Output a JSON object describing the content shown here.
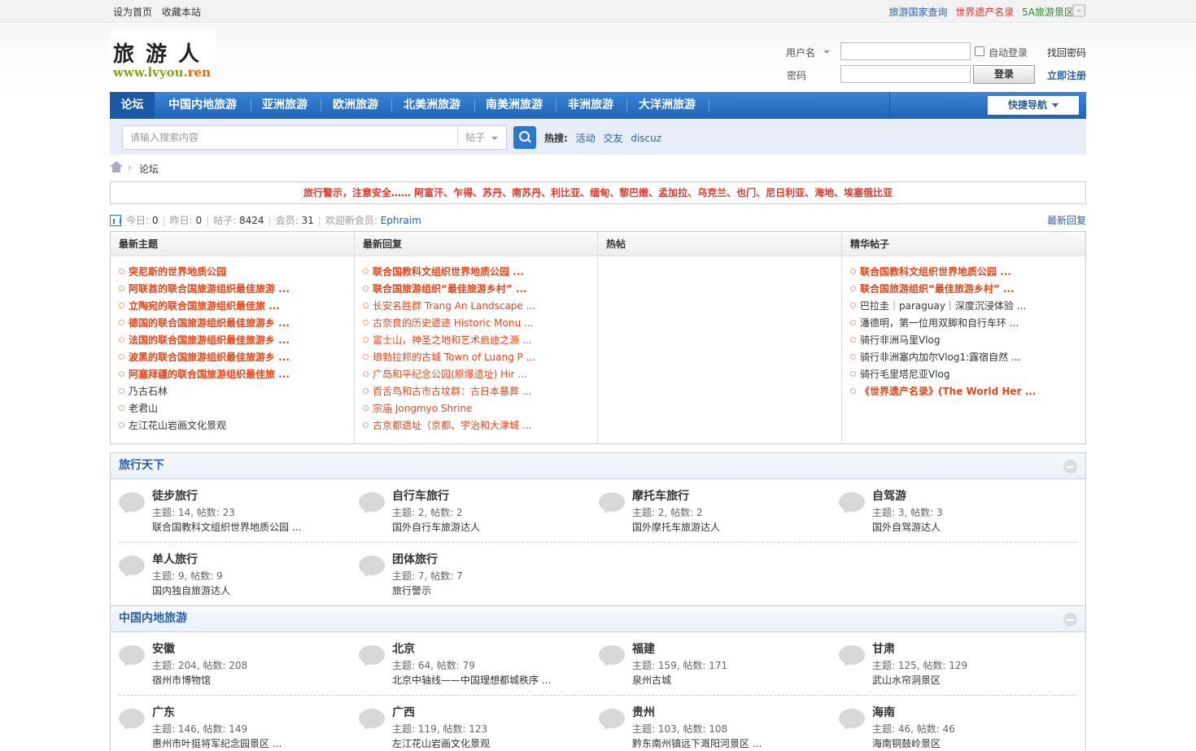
{
  "topbar": {
    "left": [
      "设为首页",
      "收藏本站"
    ],
    "right": [
      {
        "label": "旅游国家查询",
        "color": "#2a5fa7"
      },
      {
        "label": "世界遗产名录",
        "color": "#e4362b"
      },
      {
        "label": "5A旅游景区",
        "color": "#2c8a2c"
      }
    ]
  },
  "logo": {
    "cn": "旅游人",
    "url_prefix": "www.lvyou.",
    "url_suffix": "ren"
  },
  "login": {
    "username_label": "用户名",
    "password_label": "密码",
    "auto_login": "自动登录",
    "find_password": "找回密码",
    "login_button": "登录",
    "register": "立即注册",
    "username_value": "",
    "password_value": ""
  },
  "nav": {
    "items": [
      "论坛",
      "中国内地旅游",
      "亚洲旅游",
      "欧洲旅游",
      "北美洲旅游",
      "南美洲旅游",
      "非洲旅游",
      "大洋洲旅游"
    ],
    "quick": "快捷导航"
  },
  "search": {
    "placeholder": "请输入搜索内容",
    "type": "帖子",
    "hot_label": "热搜:",
    "hot": [
      "活动",
      "交友",
      "discuz"
    ]
  },
  "breadcrumb": {
    "current": "论坛"
  },
  "notice": "旅行警示，注意安全…… 阿富汗、乍得、苏丹、南苏丹、利比亚、缅甸、黎巴嫩、孟加拉、乌克兰、也门、尼日利亚、海地、埃塞俄比亚",
  "stats": {
    "today_label": "今日:",
    "today": "0",
    "yesterday_label": "昨日:",
    "yesterday": "0",
    "posts_label": "帖子:",
    "posts": "8424",
    "members_label": "会员:",
    "members": "31",
    "newmember_label": "欢迎新会员:",
    "newmember": "Ephraim",
    "latest_link": "最新回复"
  },
  "columns": [
    {
      "title": "最新主题",
      "items": [
        {
          "text": "突尼斯的世界地质公园",
          "style": "bold-red"
        },
        {
          "text": "阿联酋的联合国旅游组织最佳旅游 ...",
          "style": "bold-red"
        },
        {
          "text": "立陶宛的联合国旅游组织最佳旅 ...",
          "style": "bold-red"
        },
        {
          "text": "德国的联合国旅游组织最佳旅游乡 ...",
          "style": "bold-red"
        },
        {
          "text": "法国的联合国旅游组织最佳旅游乡 ...",
          "style": "bold-red"
        },
        {
          "text": "波黑的联合国旅游组织最佳旅游乡 ...",
          "style": "bold-red"
        },
        {
          "text": "阿塞拜疆的联合国旅游组织最佳旅 ...",
          "style": "bold-red"
        },
        {
          "text": "乃古石林",
          "style": "dark"
        },
        {
          "text": "老君山",
          "style": "dark"
        },
        {
          "text": "左江花山岩画文化景观",
          "style": "dark"
        }
      ]
    },
    {
      "title": "最新回复",
      "items": [
        {
          "text": "联合国教科文组织世界地质公园 ...",
          "style": "bold-red"
        },
        {
          "text": "联合国旅游组织“最佳旅游乡村” ...",
          "style": "bold-red"
        },
        {
          "text": "长安名胜群 Trang An Landscape ...",
          "style": "red"
        },
        {
          "text": "古奈良的历史遗迹 Historic Monu ...",
          "style": "red"
        },
        {
          "text": "富士山，神圣之地和艺术启迪之源 ...",
          "style": "red"
        },
        {
          "text": "琅勃拉邦的古城 Town of Luang P ...",
          "style": "red"
        },
        {
          "text": "广岛和平纪念公园(原爆遗址) Hir ...",
          "style": "red"
        },
        {
          "text": "百舌鸟和古市古坟群：古日本墓葬 ...",
          "style": "red"
        },
        {
          "text": "宗庙 Jongmyo Shrine",
          "style": "red"
        },
        {
          "text": "古京都遗址（京都、宇治和大津城 ...",
          "style": "red"
        }
      ]
    },
    {
      "title": "热帖",
      "items": []
    },
    {
      "title": "精华帖子",
      "items": [
        {
          "text": "联合国教科文组织世界地质公园 ...",
          "style": "bold-red"
        },
        {
          "text": "联合国旅游组织“最佳旅游乡村” ...",
          "style": "bold-red"
        },
        {
          "text": "巴拉圭｜paraguay｜深度沉浸体验 ...",
          "style": "dark"
        },
        {
          "text": "潘德明，第一位用双脚和自行车环 ...",
          "style": "dark"
        },
        {
          "text": "骑行非洲马里Vlog",
          "style": "dark"
        },
        {
          "text": "骑行非洲塞内加尔Vlog1:露宿自然 ...",
          "style": "dark"
        },
        {
          "text": "骑行毛里塔尼亚Vlog",
          "style": "dark"
        },
        {
          "text": "《世界遗产名录》(The World Her ...",
          "style": "bold-red"
        }
      ]
    }
  ],
  "sections": [
    {
      "title": "旅行天下",
      "forums": [
        {
          "name": "徒步旅行",
          "stats": "主题: 14, 帖数: 23",
          "last": "联合国教科文组织世界地质公园 ..."
        },
        {
          "name": "自行车旅行",
          "stats": "主题: 2, 帖数: 2",
          "last": "国外自行车旅游达人"
        },
        {
          "name": "摩托车旅行",
          "stats": "主题: 2, 帖数: 2",
          "last": "国外摩托车旅游达人"
        },
        {
          "name": "自驾游",
          "stats": "主题: 3, 帖数: 3",
          "last": "国外自驾游达人"
        },
        {
          "name": "单人旅行",
          "stats": "主题: 9, 帖数: 9",
          "last": "国内独自旅游达人"
        },
        {
          "name": "团体旅行",
          "stats": "主题: 7, 帖数: 7",
          "last": "旅行警示"
        }
      ]
    },
    {
      "title": "中国内地旅游",
      "forums": [
        {
          "name": "安徽",
          "stats": "主题: 204, 帖数: 208",
          "last": "宿州市博物馆"
        },
        {
          "name": "北京",
          "stats": "主题: 64, 帖数: 79",
          "last": "北京中轴线——中国理想都城秩序 ..."
        },
        {
          "name": "福建",
          "stats": "主题: 159, 帖数: 171",
          "last": "泉州古城"
        },
        {
          "name": "甘肃",
          "stats": "主题: 125, 帖数: 129",
          "last": "武山水帘洞景区"
        },
        {
          "name": "广东",
          "stats": "主题: 146, 帖数: 149",
          "last": "惠州市叶挺将军纪念园景区 ..."
        },
        {
          "name": "广西",
          "stats": "主题: 119, 帖数: 123",
          "last": "左江花山岩画文化景观"
        },
        {
          "name": "贵州",
          "stats": "主题: 103, 帖数: 108",
          "last": "黔东南州镇远下溉阳河景区 ..."
        },
        {
          "name": "海南",
          "stats": "主题: 46, 帖数: 46",
          "last": "海南铜鼓岭景区"
        }
      ]
    }
  ]
}
